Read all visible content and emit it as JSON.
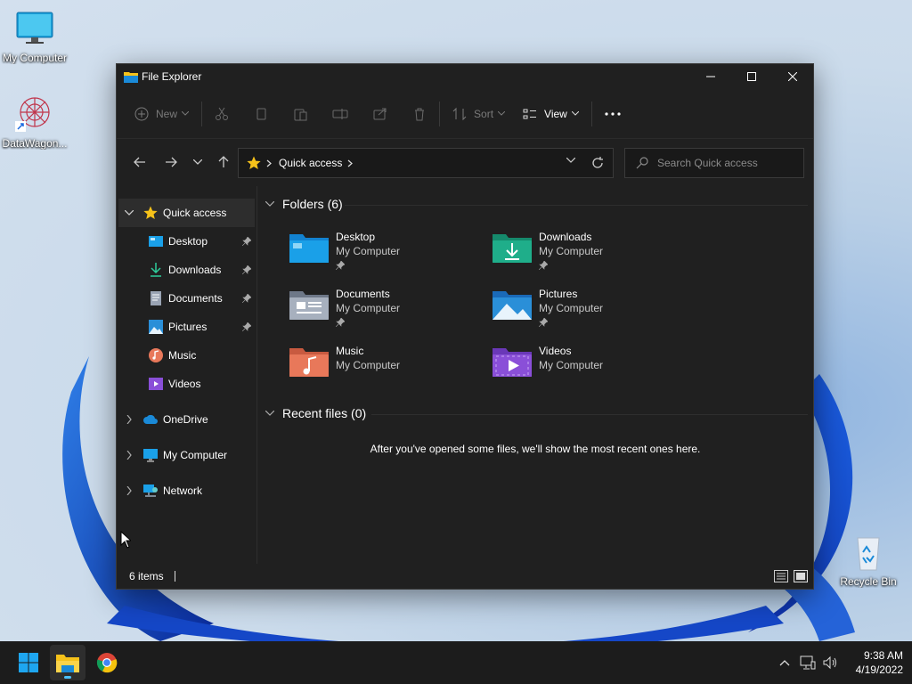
{
  "desktop": {
    "icons": [
      {
        "label": "My Computer"
      },
      {
        "label": "DataWagon..."
      },
      {
        "label": "Recycle Bin"
      }
    ]
  },
  "window": {
    "title": "File Explorer",
    "toolbar": {
      "new_label": "New",
      "sort_label": "Sort",
      "view_label": "View"
    },
    "address": {
      "path": "Quick access",
      "search_placeholder": "Search Quick access"
    },
    "sidebar": {
      "quick_access": "Quick access",
      "pinned": [
        {
          "label": "Desktop",
          "icon": "desktop-icon",
          "pinned": true
        },
        {
          "label": "Downloads",
          "icon": "download-icon",
          "pinned": true
        },
        {
          "label": "Documents",
          "icon": "document-icon",
          "pinned": true
        },
        {
          "label": "Pictures",
          "icon": "pictures-icon",
          "pinned": true
        },
        {
          "label": "Music",
          "icon": "music-icon",
          "pinned": false
        },
        {
          "label": "Videos",
          "icon": "videos-icon",
          "pinned": false
        }
      ],
      "roots": [
        {
          "label": "OneDrive",
          "icon": "cloud-icon"
        },
        {
          "label": "My Computer",
          "icon": "computer-icon"
        },
        {
          "label": "Network",
          "icon": "network-icon"
        }
      ]
    },
    "main": {
      "folders_heading": "Folders (6)",
      "folders": [
        {
          "name": "Desktop",
          "location": "My Computer",
          "pinned": true,
          "color": "#1aa0e8"
        },
        {
          "name": "Downloads",
          "location": "My Computer",
          "pinned": true,
          "color": "#1fae8a"
        },
        {
          "name": "Documents",
          "location": "My Computer",
          "pinned": true,
          "color": "#8e98a8"
        },
        {
          "name": "Pictures",
          "location": "My Computer",
          "pinned": true,
          "color": "#2a8fd8"
        },
        {
          "name": "Music",
          "location": "My Computer",
          "pinned": false,
          "color": "#e8785a"
        },
        {
          "name": "Videos",
          "location": "My Computer",
          "pinned": false,
          "color": "#8a4fd8"
        }
      ],
      "recent_heading": "Recent files (0)",
      "recent_empty": "After you've opened some files, we'll show the most recent ones here."
    },
    "status": {
      "items": "6 items"
    }
  },
  "taskbar": {
    "time": "9:38 AM",
    "date": "4/19/2022"
  },
  "colors": {
    "accent": "#4cc2ff",
    "window_bg": "#202020",
    "star": "#f6c21a"
  }
}
